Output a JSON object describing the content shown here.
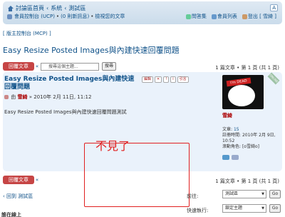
{
  "nav": {
    "breadcrumb": [
      "討論區首頁",
      "系統",
      "測試區"
    ],
    "font_ctrl": "A",
    "user_links": [
      "會員控制台 (UCP)",
      "(0 則新訊息)",
      "檢視您的文章"
    ],
    "right_links": [
      "問答集",
      "會員列表",
      "登出 [ 雪綺 ]"
    ]
  },
  "mcp_link": "[ 版主控制台 (MCP) ]",
  "topic_title": "Easy Resize Posted Images與內建快速回覆問題",
  "reply_button": "回覆文章",
  "search_placeholder": "搜尋這個主題...",
  "search_button": "搜尋",
  "pagination_top": "1 篇文章 • 第 1 頁 (共 1 頁)",
  "post": {
    "title": "Easy Resize Posted Images與內建快速回覆問題",
    "meta_prefix": "由",
    "author": "雪綺",
    "date": "» 2010年 2月 11日, 11:12",
    "body": "Easy Resize Posted Images與內建快速回覆問題測試",
    "buttons": [
      "編輯",
      "✕",
      "!",
      "i",
      "引言"
    ]
  },
  "profile": {
    "avatar_text": "I'm DEAD",
    "online_badge": "ONLINE",
    "username": "雪綺",
    "posts_label": "文章:",
    "posts_value": "15",
    "joined_label": "註冊時間:",
    "joined_value": "2010年 2月 9日, 10:52",
    "rank_label": "滾動角色:",
    "rank_value": "[o雪綺o]"
  },
  "annotation": "不見了",
  "pagination_bottom": "1 篇文章 • 第 1 頁 (共 1 頁)",
  "back_link": "‹ 回到 測試區",
  "jump": {
    "label": "前往:",
    "value": "測試區",
    "go": "Go"
  },
  "quick_actions": {
    "label": "快速執行:",
    "value": "鎖定主題",
    "go": "Go"
  },
  "who_online": "誰在線上"
}
